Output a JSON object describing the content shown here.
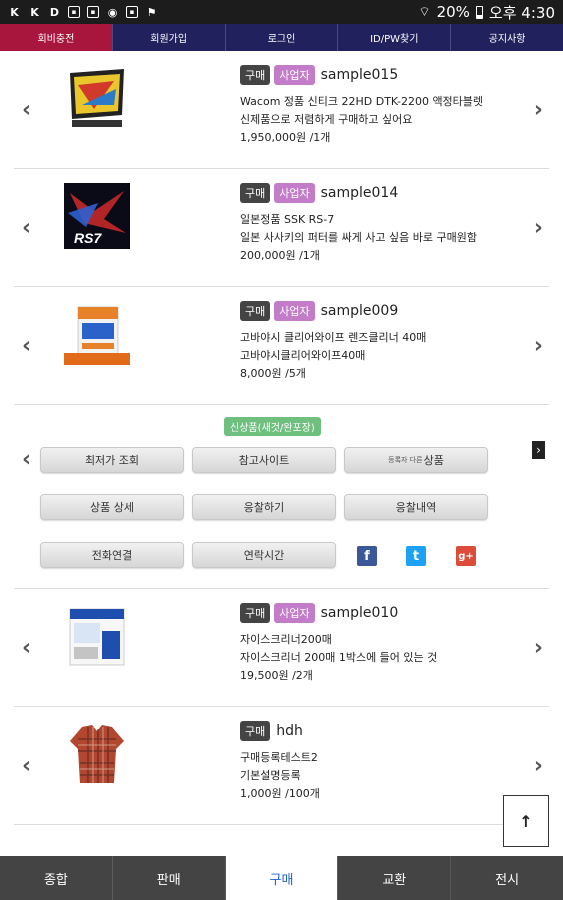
{
  "status_bar": {
    "battery": "20%",
    "time": "오후 4:30",
    "notification_icons": [
      "k-icon",
      "k-icon",
      "d-icon",
      "image-icon",
      "image-icon",
      "chrome-icon",
      "image-icon",
      "flag-icon"
    ]
  },
  "top_menu": {
    "items": [
      "회비충전",
      "회원가입",
      "로그인",
      "ID/PW찾기",
      "공지사항"
    ],
    "active_index": 0
  },
  "items": [
    {
      "tags": [
        "구매",
        "사업자"
      ],
      "username": "sample015",
      "title": "Wacom 정품 신티크 22HD DTK-2200 액정타블렛",
      "description": "신제품으로 저렴하게 구매하고 싶어요",
      "price": "1,950,000원 /1개",
      "thumb": "tablet-thumbnail"
    },
    {
      "tags": [
        "구매",
        "사업자"
      ],
      "username": "sample014",
      "title": "일본정품 SSK RS-7",
      "description": "일본 사사키의 퍼터를 싸게 사고 싶음 바로 구매원함",
      "price": "200,000원 /1개",
      "thumb": "rs7-thumbnail",
      "thumb_text": "RS7"
    },
    {
      "tags": [
        "구매",
        "사업자"
      ],
      "username": "sample009",
      "title": "고바야시 클리어와이프 렌즈클리너 40매",
      "description": "고바야시클리어와이프40매",
      "price": "8,000원 /5개",
      "thumb": "cleaner-box-thumbnail"
    }
  ],
  "panel": {
    "badge": "신상품(새것/완포장)",
    "buttons": [
      {
        "label": "최저가 조회",
        "prefix": ""
      },
      {
        "label": "참고사이트",
        "prefix": ""
      },
      {
        "label": "상품",
        "prefix": "등록자 다른"
      },
      {
        "label": "상품 상세",
        "prefix": ""
      },
      {
        "label": "응찰하기",
        "prefix": ""
      },
      {
        "label": "응찰내역",
        "prefix": ""
      },
      {
        "label": "전화연결",
        "prefix": ""
      },
      {
        "label": "연락시간",
        "prefix": ""
      }
    ],
    "social": [
      "f",
      "t",
      "g+"
    ]
  },
  "items_after": [
    {
      "tags": [
        "구매",
        "사업자"
      ],
      "username": "sample010",
      "title": "자이스크리너200매",
      "description": "자이스크리너 200매 1박스에 들어 있는 것",
      "price": "19,500원 /2개",
      "thumb": "zeiss-box-thumbnail"
    },
    {
      "tags": [
        "구매"
      ],
      "username": "hdh",
      "title": "구매등록테스트2",
      "description": "기본설명등록",
      "price": "1,000원 /100개",
      "thumb": "shirt-thumbnail"
    }
  ],
  "scroll_top_label": "↑",
  "bottom_nav": {
    "items": [
      "종합",
      "판매",
      "구매",
      "교환",
      "전시"
    ],
    "active_index": 2
  },
  "colors": {
    "top_menu_bg": "#21215e",
    "top_menu_active": "#a8163d",
    "seller_tag": "#c27cc8",
    "buy_tag": "#444444",
    "new_badge": "#6fbf7f",
    "bottom_nav_bg": "#444444",
    "bottom_nav_active_text": "#1a5fd0"
  }
}
